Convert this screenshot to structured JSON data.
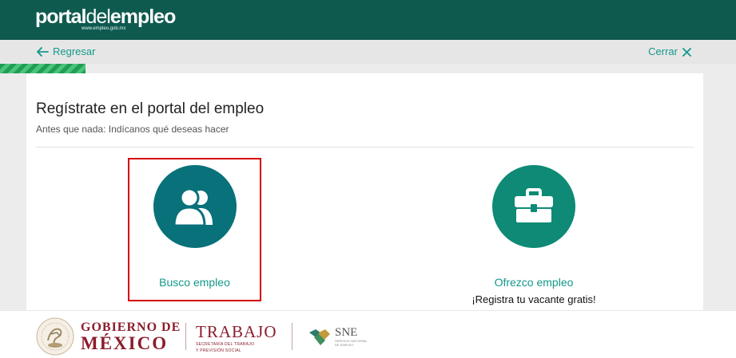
{
  "header": {
    "logo_bold": "portal",
    "logo_light": "del",
    "logo_bold2": "empleo",
    "logo_url": "www.empleo.gob.mx"
  },
  "nav": {
    "back_label": "Regresar",
    "close_label": "Cerrar"
  },
  "progress": {
    "value": 0.116
  },
  "card": {
    "title": "Regístrate en el portal del empleo",
    "subtitle": "Antes que nada: Indícanos qué deseas hacer"
  },
  "options": {
    "seeker": {
      "label": "Busco empleo",
      "icon": "users-icon"
    },
    "employer": {
      "label": "Ofrezco empleo",
      "note": "¡Registra tu vacante gratis!",
      "icon": "briefcase-icon"
    }
  },
  "footer": {
    "gob_line1": "GOBIERNO DE",
    "gob_line2": "MÉXICO",
    "trabajo": "TRABAJO",
    "trabajo_sub1": "SECRETARÍA DEL TRABAJO",
    "trabajo_sub2": "Y PREVISIÓN SOCIAL",
    "sne": "SNE",
    "sne_sub1": "SERVICIO NACIONAL",
    "sne_sub2": "DE EMPLEO"
  },
  "colors": {
    "header": "#0e5a4f",
    "accent": "#13988a",
    "progress": "#1f9d55",
    "highlight_border": "#d50000",
    "gov": "#8b1d2c"
  }
}
